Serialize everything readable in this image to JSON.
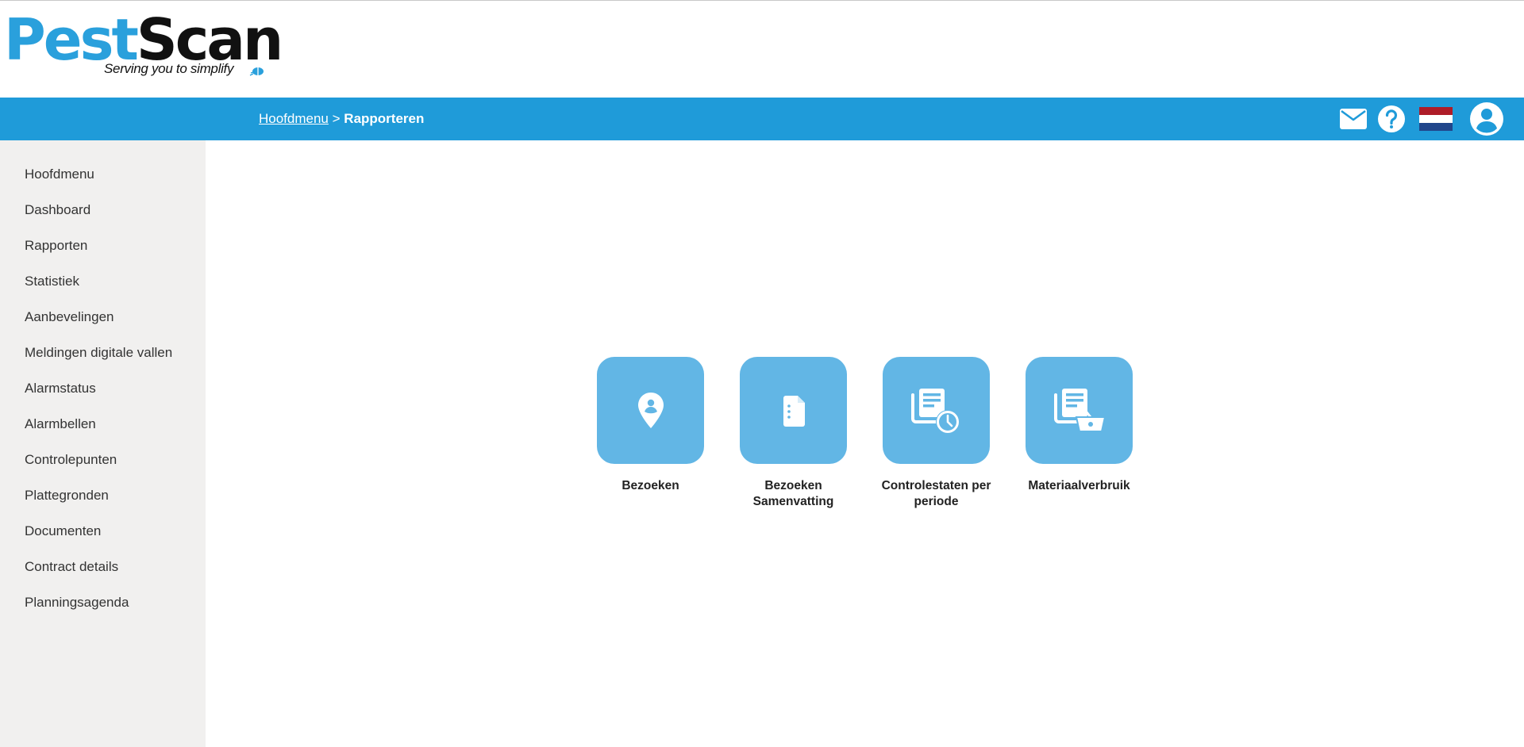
{
  "brand": {
    "name_part1": "Pest",
    "name_part2": "Scan",
    "tagline": "Serving you to simplify"
  },
  "breadcrumb": {
    "parent": "Hoofdmenu",
    "separator": ">",
    "current": "Rapporteren"
  },
  "header_icons": [
    "mail-icon",
    "help-icon",
    "flag-nl-icon",
    "user-account-icon"
  ],
  "sidebar": {
    "items": [
      {
        "label": "Hoofdmenu"
      },
      {
        "label": "Dashboard"
      },
      {
        "label": "Rapporten"
      },
      {
        "label": "Statistiek"
      },
      {
        "label": "Aanbevelingen"
      },
      {
        "label": "Meldingen digitale vallen"
      },
      {
        "label": "Alarmstatus"
      },
      {
        "label": "Alarmbellen"
      },
      {
        "label": "Controlepunten"
      },
      {
        "label": "Plattegronden"
      },
      {
        "label": "Documenten"
      },
      {
        "label": "Contract details"
      },
      {
        "label": "Planningsagenda"
      }
    ]
  },
  "tiles": [
    {
      "label": "Bezoeken",
      "icon": "location-person-icon"
    },
    {
      "label": "Bezoeken Samenvatting",
      "icon": "document-icon"
    },
    {
      "label": "Controlestaten per periode",
      "icon": "documents-clock-icon"
    },
    {
      "label": "Materiaalverbruik",
      "icon": "documents-basket-icon"
    }
  ],
  "colors": {
    "brand_blue": "#2aa0dc",
    "navbar": "#1f9bd9",
    "tile": "#62b6e5",
    "sidebar_bg": "#f1f0ef"
  }
}
